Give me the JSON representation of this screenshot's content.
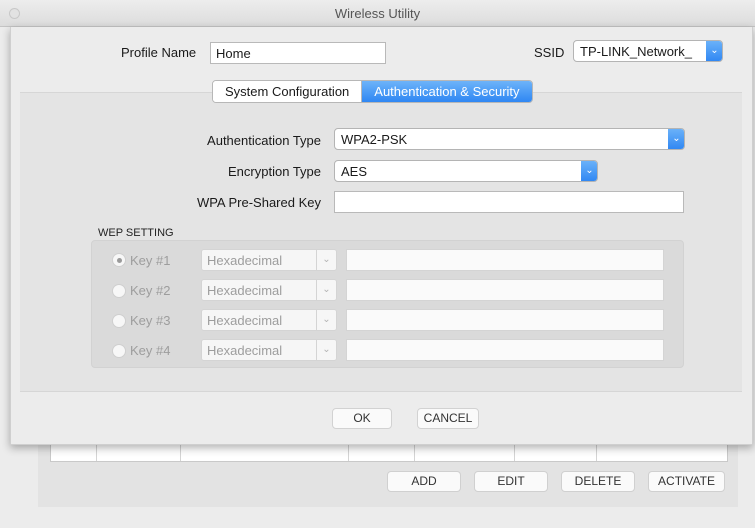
{
  "window": {
    "title": "Wireless Utility"
  },
  "profile": {
    "label": "Profile Name",
    "value": "Home"
  },
  "ssid": {
    "label": "SSID",
    "value": "TP-LINK_Network_"
  },
  "tabs": [
    {
      "label": "System Configuration",
      "active": false
    },
    {
      "label": "Authentication & Security",
      "active": true
    }
  ],
  "auth": {
    "type_label": "Authentication Type",
    "type_value": "WPA2-PSK",
    "enc_label": "Encryption Type",
    "enc_value": "AES",
    "psk_label": "WPA Pre-Shared Key",
    "psk_value": ""
  },
  "wep": {
    "title": "WEP SETTING",
    "keys": [
      {
        "label": "Key #1",
        "format": "Hexadecimal",
        "value": "",
        "selected": true
      },
      {
        "label": "Key #2",
        "format": "Hexadecimal",
        "value": "",
        "selected": false
      },
      {
        "label": "Key #3",
        "format": "Hexadecimal",
        "value": "",
        "selected": false
      },
      {
        "label": "Key #4",
        "format": "Hexadecimal",
        "value": "",
        "selected": false
      }
    ]
  },
  "dialog_buttons": {
    "ok": "OK",
    "cancel": "CANCEL"
  },
  "list_buttons": {
    "add": "ADD",
    "edit": "EDIT",
    "delete": "DELETE",
    "activate": "ACTIVATE"
  },
  "colors": {
    "accent": "#2f87f3",
    "window_bg": "#ececec",
    "panel_bg": "#e4e4e4"
  },
  "icons": {
    "dropdown": "chevron-down-icon",
    "window_button": "window-close-icon"
  }
}
